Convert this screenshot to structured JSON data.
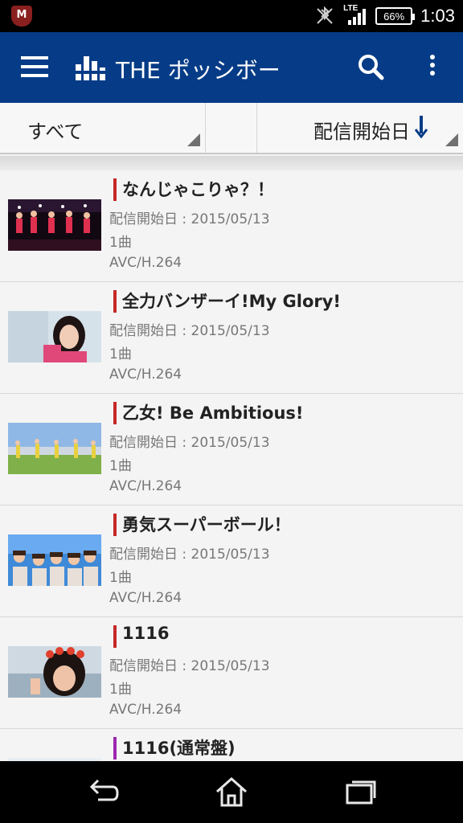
{
  "status_bar": {
    "network_type": "LTE",
    "battery": "66%",
    "time": "1:03"
  },
  "app_bar": {
    "title": "THE ポッシボー"
  },
  "filter": {
    "category": "すべて",
    "sort_label": "配信開始日"
  },
  "items": [
    {
      "title": "なんじゃこりゃ？！",
      "date": "配信開始日 : 2015/05/13",
      "count": "1曲",
      "codec": "AVC/H.264",
      "accent": "#c62828"
    },
    {
      "title": "全力バンザーイ!My Glory!",
      "date": "配信開始日 : 2015/05/13",
      "count": "1曲",
      "codec": "AVC/H.264",
      "accent": "#c62828"
    },
    {
      "title": "乙女! Be Ambitious!",
      "date": "配信開始日 : 2015/05/13",
      "count": "1曲",
      "codec": "AVC/H.264",
      "accent": "#c62828"
    },
    {
      "title": "勇気スーパーボール！",
      "date": "配信開始日 : 2015/05/13",
      "count": "1曲",
      "codec": "AVC/H.264",
      "accent": "#c62828"
    },
    {
      "title": "1116",
      "date": "配信開始日 : 2015/05/13",
      "count": "1曲",
      "codec": "AVC/H.264",
      "accent": "#c62828"
    },
    {
      "title": "1116(通常盤)",
      "date": "",
      "count": "",
      "codec": "",
      "accent": "#9c27b0"
    }
  ],
  "colors": {
    "app_bar": "#063c87",
    "accent_red": "#c62828",
    "accent_purple": "#9c27b0",
    "status_bar": "#000000"
  }
}
